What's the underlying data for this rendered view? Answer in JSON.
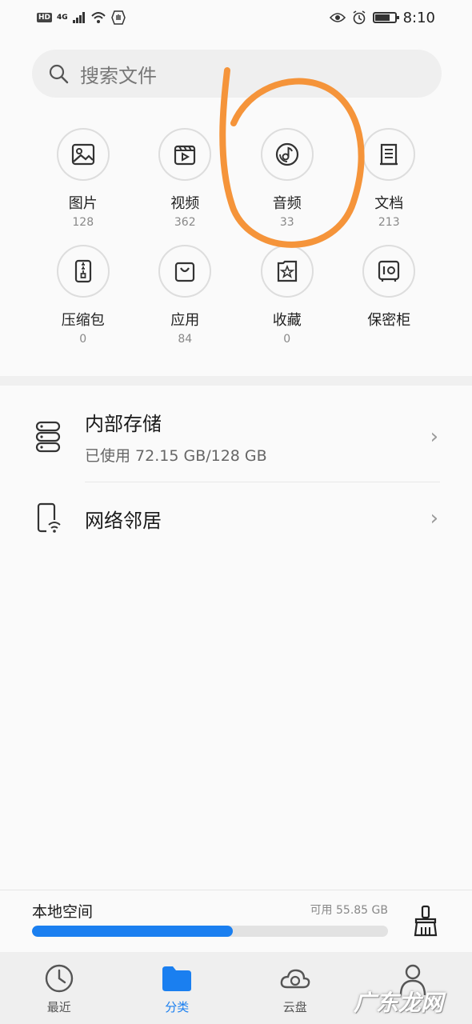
{
  "status_bar": {
    "hd": "HD",
    "network": "4G",
    "time": "8:10"
  },
  "search": {
    "placeholder": "搜索文件"
  },
  "categories": [
    {
      "name": "图片",
      "count": "128",
      "icon": "image-icon"
    },
    {
      "name": "视频",
      "count": "362",
      "icon": "video-icon"
    },
    {
      "name": "音频",
      "count": "33",
      "icon": "music-disc-icon"
    },
    {
      "name": "文档",
      "count": "213",
      "icon": "document-icon"
    },
    {
      "name": "压缩包",
      "count": "0",
      "icon": "zip-icon"
    },
    {
      "name": "应用",
      "count": "84",
      "icon": "shopping-bag-icon"
    },
    {
      "name": "收藏",
      "count": "0",
      "icon": "star-icon"
    },
    {
      "name": "保密柜",
      "count": "",
      "icon": "safe-icon"
    }
  ],
  "storage": {
    "internal_title": "内部存储",
    "internal_sub": "已使用 72.15 GB/128 GB",
    "network_title": "网络邻居"
  },
  "local_space": {
    "title": "本地空间",
    "available": "可用 55.85 GB",
    "used_fraction": 0.5637
  },
  "nav": [
    {
      "label": "最近",
      "icon": "clock-icon"
    },
    {
      "label": "分类",
      "icon": "folder-icon",
      "active": true
    },
    {
      "label": "云盘",
      "icon": "cloud-icon"
    },
    {
      "label": "",
      "icon": "person-icon"
    }
  ],
  "watermark": "广东龙网",
  "colors": {
    "accent": "#1a7ff0",
    "annotation": "#f5943a"
  }
}
